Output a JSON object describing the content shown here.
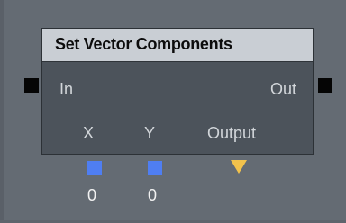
{
  "node": {
    "title": "Set Vector Components",
    "exec_in_label": "In",
    "exec_out_label": "Out",
    "inputs": [
      {
        "label": "X",
        "value": "0",
        "port_color": "#4f7ef2"
      },
      {
        "label": "Y",
        "value": "0",
        "port_color": "#4f7ef2"
      }
    ],
    "output": {
      "label": "Output",
      "port_color": "#f2c24c"
    }
  },
  "colors": {
    "canvas": "#646b73",
    "node_body": "#4c535b",
    "header": "#c9ced4",
    "exec_port": "#050505"
  }
}
